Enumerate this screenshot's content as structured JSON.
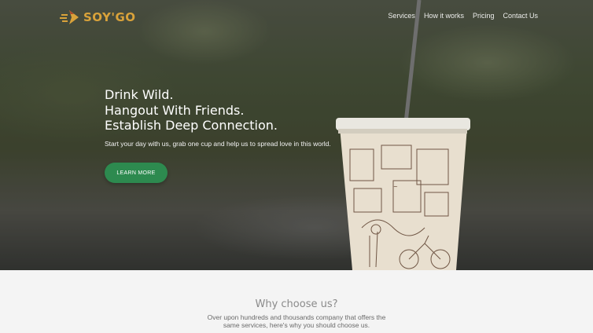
{
  "brand": {
    "name": "SOY'GO",
    "color": "#d9a23a",
    "icon": "delivery-cup-logo-icon"
  },
  "nav": {
    "items": [
      {
        "label": "Services"
      },
      {
        "label": "How it works"
      },
      {
        "label": "Pricing"
      },
      {
        "label": "Contact Us"
      }
    ]
  },
  "hero": {
    "title_lines": [
      "Drink Wild.",
      "Hangout With Friends.",
      "Establish Deep Connection."
    ],
    "subtitle": "Start your day with us, grab one cup and help us to spread love in this world.",
    "cta_label": "LEARN MORE",
    "cta_color": "#2d8a4f",
    "background": "blurred-outdoor-photo-with-paper-cup"
  },
  "why": {
    "title": "Why choose us?",
    "description": "Over upon hundreds and thousands company that offers the same services, here's why you should choose us."
  }
}
